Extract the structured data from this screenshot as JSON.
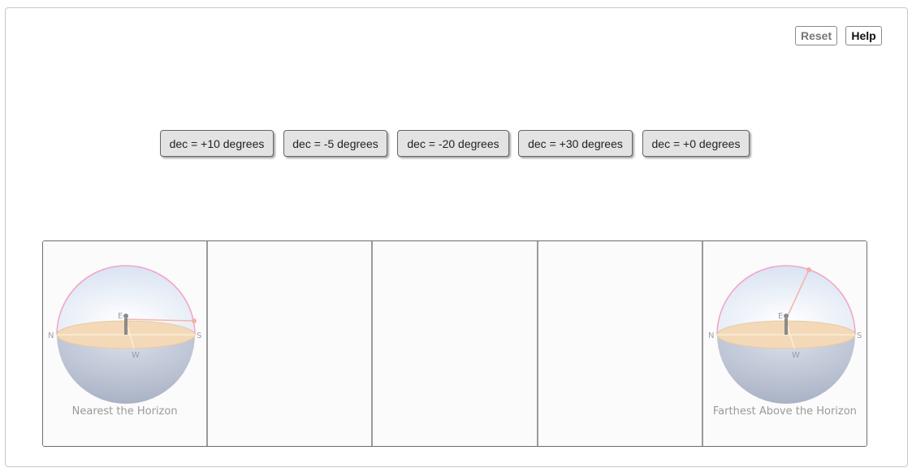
{
  "toolbar": {
    "reset_label": "Reset",
    "help_label": "Help"
  },
  "choices": [
    {
      "label": "dec = +10 degrees"
    },
    {
      "label": "dec = -5 degrees"
    },
    {
      "label": "dec = -20 degrees"
    },
    {
      "label": "dec = +30 degrees"
    },
    {
      "label": "dec = +0 degrees"
    }
  ],
  "ranking": {
    "slots": [
      {
        "caption": "Nearest the Horizon",
        "image": "celestial-sphere-low-star"
      },
      {
        "caption": "",
        "image": ""
      },
      {
        "caption": "",
        "image": ""
      },
      {
        "caption": "",
        "image": ""
      },
      {
        "caption": "Farthest Above the Horizon",
        "image": "celestial-sphere-high-star"
      }
    ]
  },
  "sphere_labels": {
    "north": "N",
    "south": "S",
    "east": "E",
    "west": "W"
  },
  "colors": {
    "chip_bg": "#e3e3e3",
    "dome": "#e8eef8",
    "horizon": "#f3d9b8",
    "meridian": "#f2a7c6",
    "lower_hemisphere": "#b8c0d0"
  }
}
